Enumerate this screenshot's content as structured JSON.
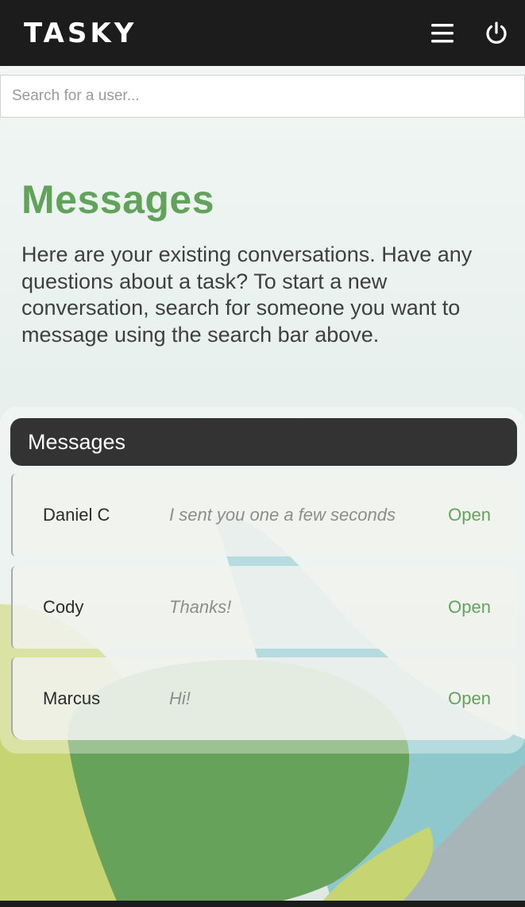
{
  "header": {
    "logo": "TASKY",
    "menu_icon": "hamburger-menu-icon",
    "power_icon": "power-icon"
  },
  "search": {
    "placeholder": "Search for a user...",
    "value": ""
  },
  "intro": {
    "title": "Messages",
    "description": "Here are your existing conversations. Have any questions about a task? To start a new conversation, search for someone you want to message using the search bar above."
  },
  "messages": {
    "header": "Messages",
    "items": [
      {
        "name": "Daniel C",
        "preview": "I sent you one a few seconds",
        "action": "Open"
      },
      {
        "name": "Cody",
        "preview": "Thanks!",
        "action": "Open"
      },
      {
        "name": "Marcus",
        "preview": "Hi!",
        "action": "Open"
      }
    ]
  },
  "colors": {
    "accent": "#62a35b",
    "topbar": "#1c1c1c",
    "panel_header": "#333333"
  }
}
